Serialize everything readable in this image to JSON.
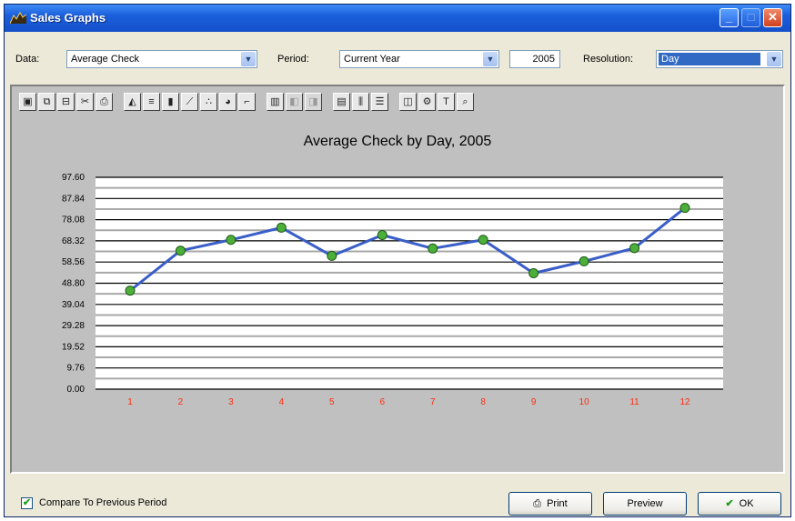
{
  "window": {
    "title": "Sales Graphs"
  },
  "titlebar_buttons": {
    "minimize": "_",
    "maximize": "□",
    "close": "✕"
  },
  "filters": {
    "data_label": "Data:",
    "data_value": "Average Check",
    "period_label": "Period:",
    "period_value": "Current Year",
    "year_value": "2005",
    "resolution_label": "Resolution:",
    "resolution_value": "Day",
    "dropdown_arrow": "▼"
  },
  "toolbar": {
    "groups": [
      {
        "items": [
          {
            "icon": "save-icon",
            "glyph": "▣"
          },
          {
            "icon": "copy-icon",
            "glyph": "⧉"
          },
          {
            "icon": "export-icon",
            "glyph": "⊟"
          },
          {
            "icon": "cut-icon",
            "glyph": "✂"
          },
          {
            "icon": "print-icon",
            "glyph": "⎙"
          }
        ]
      },
      {
        "items": [
          {
            "icon": "area-chart-icon",
            "glyph": "◭"
          },
          {
            "icon": "hbar-chart-icon",
            "glyph": "≡"
          },
          {
            "icon": "bar-chart-icon",
            "glyph": "▮"
          },
          {
            "icon": "line-chart-icon",
            "glyph": "⟋"
          },
          {
            "icon": "scatter-chart-icon",
            "glyph": "∴"
          },
          {
            "icon": "pie-chart-icon",
            "glyph": "◕"
          },
          {
            "icon": "step-chart-icon",
            "glyph": "⌐"
          }
        ]
      },
      {
        "items": [
          {
            "icon": "3d-icon",
            "glyph": "▥"
          },
          {
            "icon": "rotate-icon",
            "glyph": "◧",
            "disabled": true
          },
          {
            "icon": "perspective-icon",
            "glyph": "◨",
            "disabled": true
          }
        ]
      },
      {
        "items": [
          {
            "icon": "data-grid-icon",
            "glyph": "▤"
          },
          {
            "icon": "vertical-grid-icon",
            "glyph": "⫼"
          },
          {
            "icon": "horizontal-grid-icon",
            "glyph": "☰"
          }
        ]
      },
      {
        "items": [
          {
            "icon": "legend-icon",
            "glyph": "◫"
          },
          {
            "icon": "properties-icon",
            "glyph": "⚙"
          },
          {
            "icon": "font-icon",
            "glyph": "T"
          },
          {
            "icon": "zoom-icon",
            "glyph": "⌕"
          }
        ]
      }
    ]
  },
  "chart_data": {
    "type": "line",
    "title": "Average Check by Day, 2005",
    "categories": [
      "1",
      "2",
      "3",
      "4",
      "5",
      "6",
      "7",
      "8",
      "9",
      "10",
      "11",
      "12"
    ],
    "values": [
      45.4,
      63.8,
      68.8,
      74.4,
      61.4,
      71.0,
      64.8,
      68.8,
      53.4,
      58.9,
      65.0,
      83.5
    ],
    "yticks": [
      "97.60",
      "87.84",
      "78.08",
      "68.32",
      "58.56",
      "48.80",
      "39.04",
      "29.28",
      "19.52",
      "9.76",
      "0.00"
    ],
    "ylim": [
      0,
      97.6
    ],
    "grid": true,
    "colors": {
      "line": "#3a5ec8",
      "marker": "#4caf3a",
      "background": "#c0c0c0",
      "plot": "#ffffff",
      "xtick": "#ff2b10"
    }
  },
  "footer": {
    "compare_label": "Compare To Previous Period",
    "compare_checked": "✔",
    "print_label": "Print",
    "preview_label": "Preview",
    "ok_label": "OK"
  }
}
